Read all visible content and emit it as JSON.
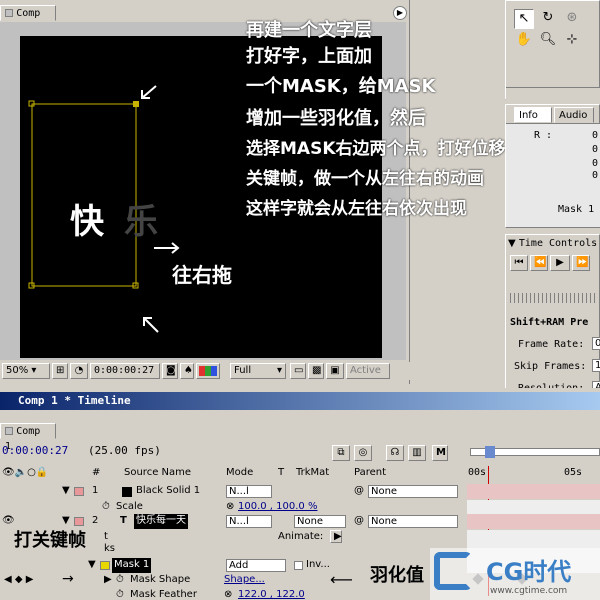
{
  "comp": {
    "tab": "Comp 1",
    "text_kuai": "快",
    "text_le": "乐",
    "annotation_lines": [
      "再建一个文字层",
      "打好字，上面加",
      "一个MASK，给MASK",
      "增加一些羽化值，然后",
      "选择MASK右边两个点，打好位移",
      "关键帧，做一个从左往右的动画",
      "这样字就会从左往右依次出现"
    ],
    "drag_right_label": "往右拖",
    "status": {
      "zoom": "50%",
      "timecode": "0:00:00:27",
      "resolution": "Full",
      "active": "Active"
    }
  },
  "info": {
    "tab_info": "Info",
    "tab_audio": "Audio",
    "r_label": "R :",
    "values": [
      "0",
      "0",
      "0",
      "0"
    ],
    "mask_label": "Mask 1"
  },
  "time_controls": {
    "title": "Time Controls",
    "ram_preview": "Shift+RAM Pre",
    "frame_rate_label": "Frame Rate:",
    "frame_rate_value": "0",
    "skip_frames_label": "Skip Frames:",
    "skip_frames_value": "1",
    "resolution_label": "Resolution:",
    "resolution_value": "A"
  },
  "timeline": {
    "title": "Comp 1 * Timeline",
    "tab": "Comp 1",
    "timecode": "0:00:00:27",
    "fps": "(25.00 fps)",
    "ruler": [
      "00s",
      "05s"
    ],
    "headers": {
      "num": "#",
      "source": "Source Name",
      "mode": "Mode",
      "t": "T",
      "trkmat": "TrkMat",
      "parent": "Parent"
    },
    "layer1": {
      "num": "1",
      "name": "Black Solid 1",
      "mode": "N...l",
      "parent": "None",
      "scale_label": "Scale",
      "scale_value": "100.0 , 100.0 %"
    },
    "layer2": {
      "num": "2",
      "name": "快乐每一天",
      "mode": "N...l",
      "trkmat": "None",
      "parent": "None",
      "animate_label": "Animate:",
      "t_label": "t",
      "ks_label": "ks"
    },
    "mask1": {
      "name": "Mask 1",
      "mode": "Add",
      "inverted": "Inv...",
      "shape_label": "Mask Shape",
      "shape_value": "Shape...",
      "feather_label": "Mask Feather",
      "feather_value": "122.0 , 122.0"
    },
    "keyframe_label": "打关键帧",
    "feather_note": "羽化值"
  },
  "watermark": {
    "brand": "CG时代",
    "url": "www.cgtime.com"
  },
  "colors": {
    "canvas": "#000000",
    "mask_outline": "#c8b400",
    "title_bar": "#0a246a",
    "layer_track": "#e8c4c4",
    "label_red": "#e89898"
  }
}
